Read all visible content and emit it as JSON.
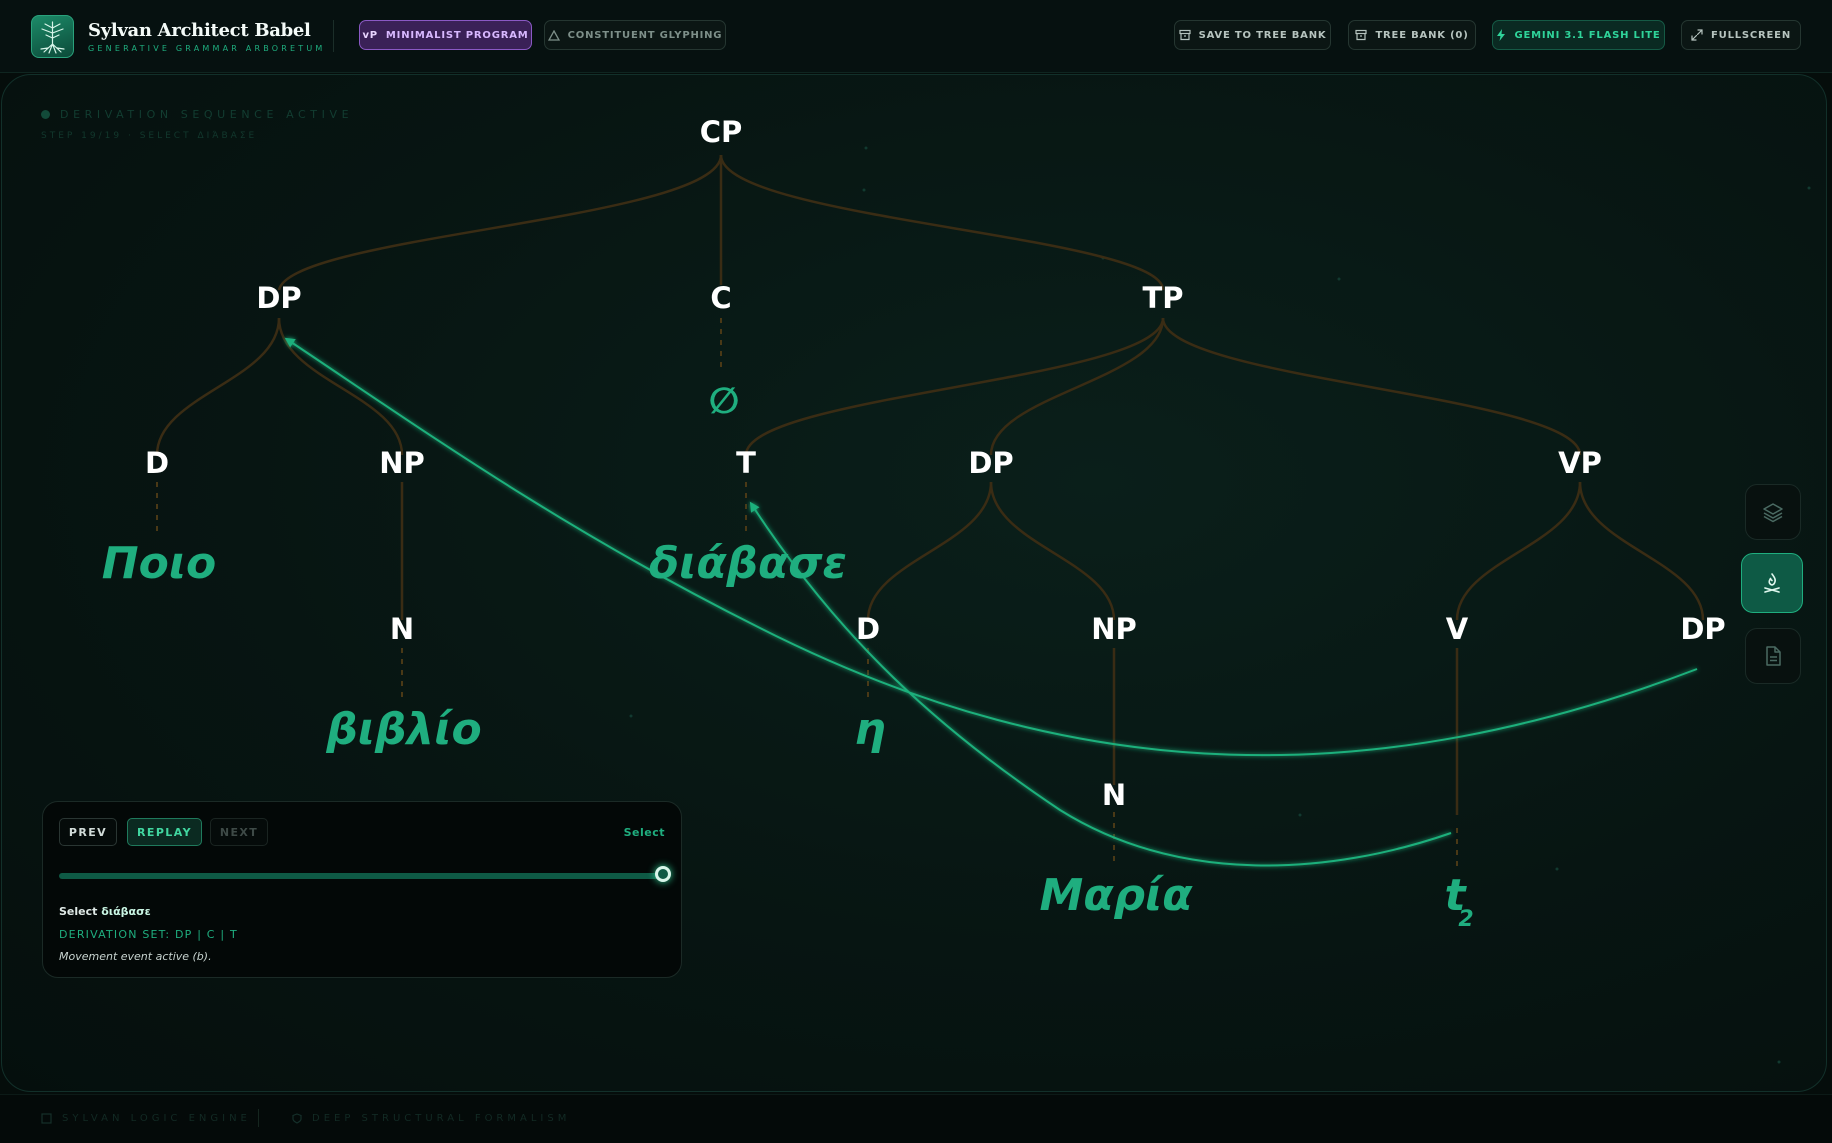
{
  "app": {
    "title": "Sylvan Architect Babel",
    "subtitle": "GENERATIVE GRAMMAR ARBORETUM"
  },
  "header": {
    "mode_minimalist": {
      "badge": "vP",
      "label": "MINIMALIST PROGRAM",
      "active": true
    },
    "mode_constituent": {
      "label": "CONSTITUENT GLYPHING",
      "active": false
    },
    "save_label": "SAVE TO TREE BANK",
    "bank_label": "TREE BANK (0)",
    "model_label": "GEMINI 3.1 FLASH LITE",
    "fullscreen_label": "FULLSCREEN"
  },
  "canvas": {
    "status": "DERIVATION SEQUENCE ACTIVE",
    "step": "STEP 19/19 · SELECT ΔΙΆΒΑΣΕ"
  },
  "tree": {
    "nodes": [
      {
        "id": "cp",
        "label": "CP"
      },
      {
        "id": "dp1",
        "label": "DP"
      },
      {
        "id": "c",
        "label": "C"
      },
      {
        "id": "tp",
        "label": "TP"
      },
      {
        "id": "d1",
        "label": "D"
      },
      {
        "id": "np1",
        "label": "NP"
      },
      {
        "id": "t",
        "label": "T"
      },
      {
        "id": "dp2",
        "label": "DP"
      },
      {
        "id": "vp",
        "label": "VP"
      },
      {
        "id": "n1",
        "label": "N"
      },
      {
        "id": "d2",
        "label": "D"
      },
      {
        "id": "np2",
        "label": "NP"
      },
      {
        "id": "v",
        "label": "V"
      },
      {
        "id": "dp3",
        "label": "DP"
      },
      {
        "id": "n2",
        "label": "N"
      }
    ],
    "leaves": [
      {
        "id": "leaf-c",
        "text": "∅"
      },
      {
        "id": "leaf-d1",
        "text": "Ποιο"
      },
      {
        "id": "leaf-t",
        "text": "διάβασε"
      },
      {
        "id": "leaf-n1",
        "text": "βιβλίο"
      },
      {
        "id": "leaf-d2",
        "text": "η"
      },
      {
        "id": "leaf-n2",
        "text": "Μαρία"
      },
      {
        "id": "leaf-v",
        "text": "t",
        "subscript": "2"
      }
    ],
    "movement_arrows": [
      {
        "from": "DP",
        "to": "DP"
      },
      {
        "from": "V",
        "to": "T"
      }
    ]
  },
  "tools": [
    {
      "name": "layers-icon",
      "active": false
    },
    {
      "name": "campfire-icon",
      "active": true
    },
    {
      "name": "document-icon",
      "active": false
    }
  ],
  "player": {
    "prev_label": "PREV",
    "replay_label": "REPLAY",
    "next_label": "NEXT",
    "mode": "Select",
    "progress": 1.0,
    "desc_prefix": "Select ",
    "desc_word": "διάβασε",
    "derivation_set": "DERIVATION SET: DP | C | T",
    "note": "Movement event active (b)."
  },
  "footer": {
    "engine": "SYLVAN LOGIC ENGINE",
    "formalism": "DEEP STRUCTURAL FORMALISM"
  },
  "colors": {
    "accent": "#1fae7f",
    "branch": "#3a2c14",
    "movement": "#1fb07c",
    "minimalist": "#8a59c4"
  }
}
